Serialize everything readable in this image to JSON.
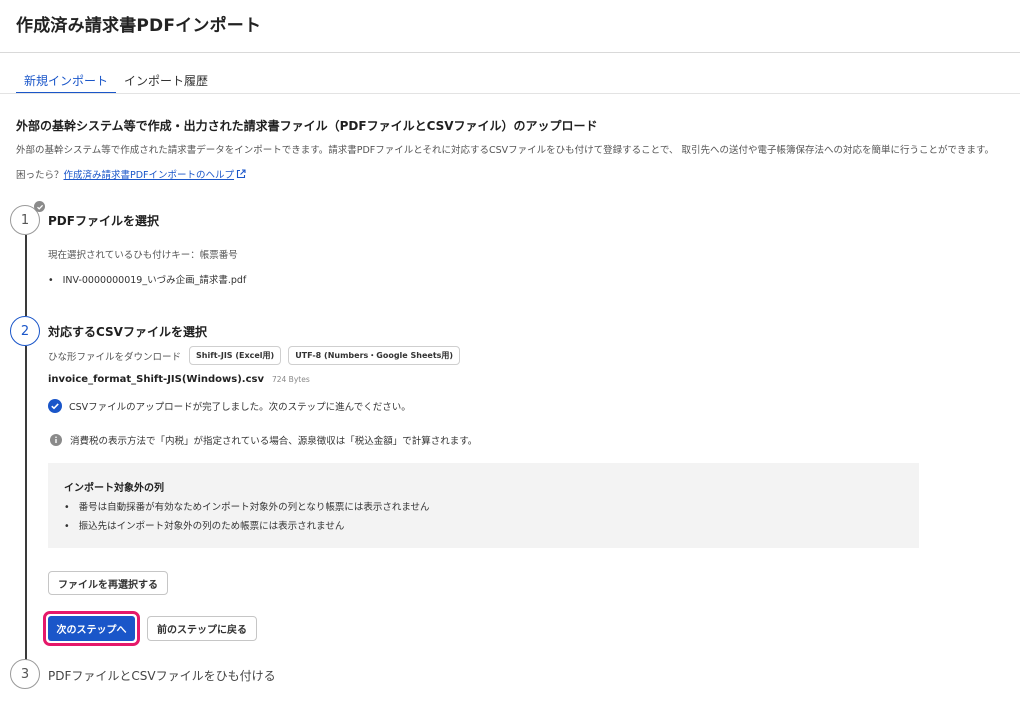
{
  "page": {
    "title": "作成済み請求書PDFインポート"
  },
  "tabs": [
    {
      "label": "新規インポート"
    },
    {
      "label": "インポート履歴"
    }
  ],
  "section": {
    "title": "外部の基幹システム等で作成・出力された請求書ファイル（PDFファイルとCSVファイル）のアップロード",
    "description": "外部の基幹システム等で作成された請求書データをインポートできます。請求書PDFファイルとそれに対応するCSVファイルをひも付けて登録することで、 取引先への送付や電子帳簿保存法への対応を簡単に行うことができます。",
    "help_prefix": "困ったら？",
    "help_link": "作成済み請求書PDFインポートのヘルプ"
  },
  "steps": [
    {
      "number": "1",
      "title": "PDFファイルを選択",
      "key_label": "現在選択されているひも付けキー：帳票番号",
      "files": [
        "INV-0000000019_いづみ企画_請求書.pdf"
      ]
    },
    {
      "number": "2",
      "title": "対応するCSVファイルを選択",
      "template_label": "ひな形ファイルをダウンロード",
      "template_buttons": [
        "Shift-JIS (Excel用)",
        "UTF-8 (Numbers・Google Sheets用)"
      ],
      "csv_file_name": "invoice_format_Shift-JIS(Windows).csv",
      "csv_file_size": "724 Bytes",
      "success_message": "CSVファイルのアップロードが完了しました。次のステップに進んでください。",
      "info_message": "消費税の表示方法で「内税」が指定されている場合、源泉徴収は「税込金額」で計算されます。",
      "excluded_title": "インポート対象外の列",
      "excluded_items": [
        "番号は自動採番が有効なためインポート対象外の列となり帳票には表示されません",
        "振込先はインポート対象外の列のため帳票には表示されません"
      ],
      "reselect_button": "ファイルを再選択する",
      "next_button": "次のステップへ",
      "back_button": "前のステップに戻る"
    },
    {
      "number": "3",
      "title": "PDFファイルとCSVファイルをひも付ける"
    }
  ],
  "colors": {
    "accent": "#1a56c9",
    "highlight": "#e5186a"
  },
  "icons": [
    "external-link-icon",
    "check-badge-icon",
    "check-circle-icon",
    "info-icon"
  ]
}
